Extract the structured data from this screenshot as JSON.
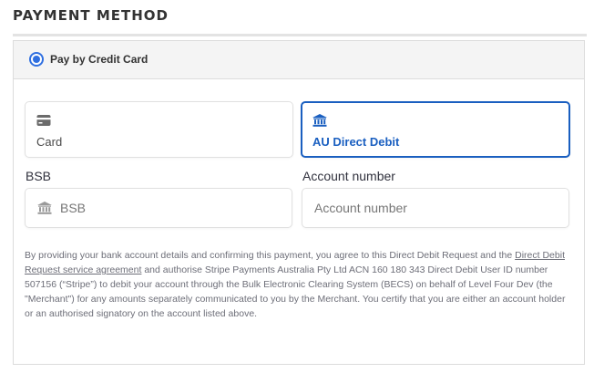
{
  "section": {
    "title": "PAYMENT METHOD"
  },
  "payment_method": {
    "option_label": "Pay by Credit Card",
    "selected": true
  },
  "tabs": [
    {
      "label": "Card",
      "icon": "credit-card-icon",
      "selected": false
    },
    {
      "label": "AU Direct Debit",
      "icon": "bank-icon",
      "selected": true
    }
  ],
  "fields": {
    "bsb": {
      "label": "BSB",
      "placeholder": "BSB",
      "value": "",
      "icon": "bank-icon"
    },
    "account_number": {
      "label": "Account number",
      "placeholder": "Account number",
      "value": ""
    }
  },
  "mandate": {
    "text_before_link": "By providing your bank account details and confirming this payment, you agree to this Direct Debit Request and the ",
    "link_text": "Direct Debit Request service agreement",
    "text_after_link": " and authorise Stripe Payments Australia Pty Ltd ACN 160 180 343 Direct Debit User ID number 507156 (“Stripe”) to debit your account through the Bulk Electronic Clearing System (BECS) on behalf of Level Four Dev (the \"Merchant\") for any amounts separately communicated to you by the Merchant. You certify that you are either an account holder or an authorised signatory on the account listed above."
  },
  "colors": {
    "accent": "#1a5fc0",
    "radio": "#2f6fe0",
    "header_bg": "#f4f4f4",
    "border": "#e0e0e0",
    "muted_text": "#6d6e78"
  }
}
